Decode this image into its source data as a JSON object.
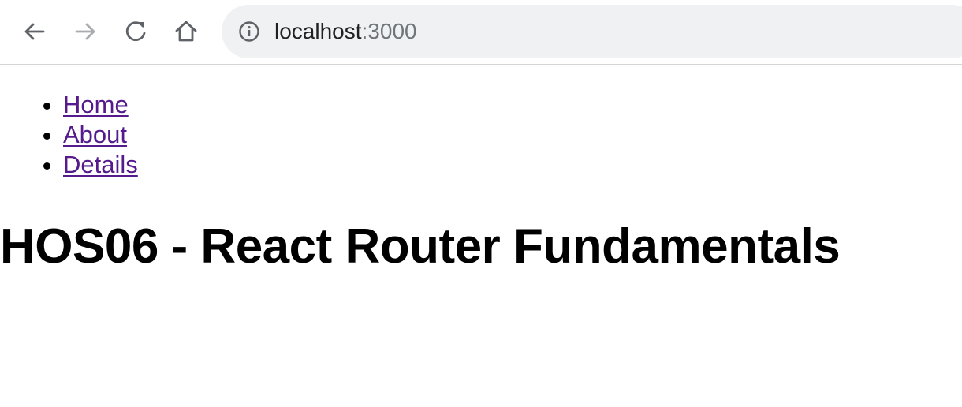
{
  "browser": {
    "toolbar": {
      "back_icon": "arrow-left-icon",
      "forward_icon": "arrow-right-icon",
      "reload_icon": "reload-icon",
      "home_icon": "home-icon"
    },
    "address_bar": {
      "security_icon": "info-circle-icon",
      "host": "localhost",
      "port": ":3000"
    },
    "colors": {
      "omnibox_bg": "#eff1f2",
      "icon_active": "#5f6368",
      "icon_disabled": "#a8abaf"
    }
  },
  "page": {
    "nav": {
      "items": [
        {
          "label": "Home"
        },
        {
          "label": "About"
        },
        {
          "label": "Details"
        }
      ]
    },
    "title": "HOS06 - React Router Fundamentals",
    "colors": {
      "link": "#551a8b",
      "text": "#000000"
    }
  }
}
